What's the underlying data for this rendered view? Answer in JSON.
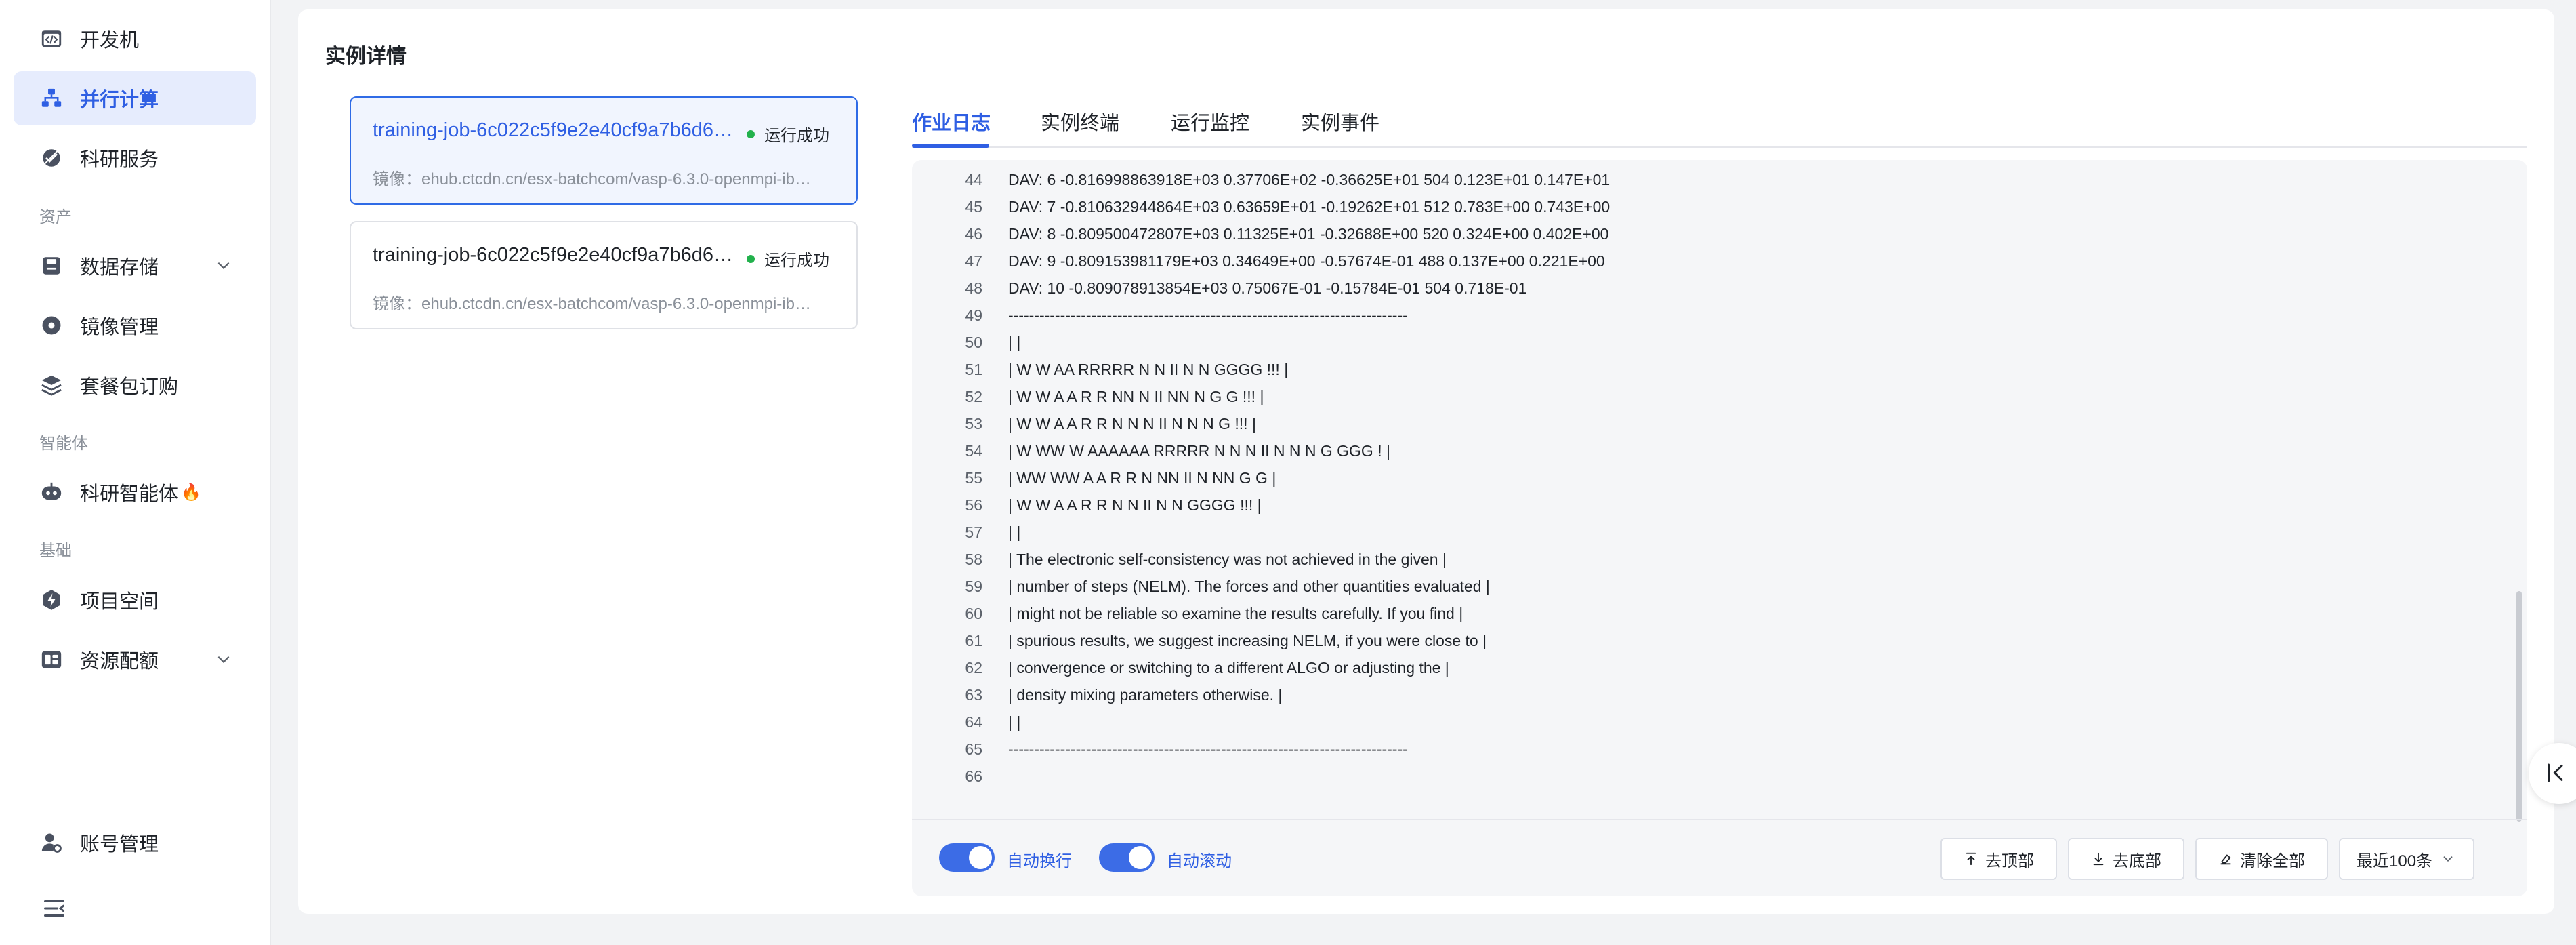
{
  "sidebar": {
    "items": [
      {
        "label": "开发机",
        "icon": "code-window-icon"
      },
      {
        "label": "并行计算",
        "icon": "cluster-icon",
        "active": true
      },
      {
        "label": "科研服务",
        "icon": "service-icon"
      },
      {
        "label": "数据存储",
        "icon": "storage-icon",
        "expandable": true
      },
      {
        "label": "镜像管理",
        "icon": "disc-icon"
      },
      {
        "label": "套餐包订购",
        "icon": "layers-icon"
      },
      {
        "label": "科研智能体",
        "icon": "robot-icon"
      },
      {
        "label": "项目空间",
        "icon": "bolt-icon"
      },
      {
        "label": "资源配额",
        "icon": "quota-icon",
        "expandable": true
      },
      {
        "label": "账号管理",
        "icon": "user-gear-icon"
      }
    ],
    "sections": [
      "资产",
      "智能体",
      "基础"
    ],
    "fire_badge": "🔥",
    "collapse_icon": "menu-collapse-icon"
  },
  "detail": {
    "title": "实例详情",
    "instances": [
      {
        "job_name": "training-job-6c022c5f9e2e40cf9a7b6d6…",
        "status": "运行成功",
        "image": "镜像：ehub.ctcdn.cn/esx-batchcom/vasp-6.3.0-openmpi-ib…",
        "selected": true
      },
      {
        "job_name": "training-job-6c022c5f9e2e40cf9a7b6d6…",
        "status": "运行成功",
        "image": "镜像：ehub.ctcdn.cn/esx-batchcom/vasp-6.3.0-openmpi-ib…",
        "selected": false
      }
    ],
    "status_color": "#22b14c"
  },
  "tabs": [
    "作业日志",
    "实例终端",
    "运行监控",
    "实例事件"
  ],
  "log": {
    "lines": [
      {
        "n": "44",
        "t": "DAV:   6    -0.816998863918E+03    0.37706E+02   -0.36625E+01   504   0.123E+01    0.147E+01"
      },
      {
        "n": "45",
        "t": "DAV:   7    -0.810632944864E+03    0.63659E+01   -0.19262E+01   512   0.783E+00    0.743E+00"
      },
      {
        "n": "46",
        "t": "DAV:   8    -0.809500472807E+03    0.11325E+01   -0.32688E+00   520   0.324E+00    0.402E+00"
      },
      {
        "n": "47",
        "t": "DAV:   9    -0.809153981179E+03    0.34649E+00   -0.57674E-01   488   0.137E+00    0.221E+00"
      },
      {
        "n": "48",
        "t": "DAV:  10    -0.809078913854E+03    0.75067E-01   -0.15784E-01   504   0.718E-01"
      },
      {
        "n": "49",
        "t": "-----------------------------------------------------------------------------"
      },
      {
        "n": "50",
        "t": "|                                                                             |"
      },
      {
        "n": "51",
        "t": "|     W    W    AA    RRRRR   N    N  II  N    N   GGGG   !!!                 |"
      },
      {
        "n": "52",
        "t": "|     W    W   A  A   R    R  NN   N  II  NN   N  G    G  !!!                 |"
      },
      {
        "n": "53",
        "t": "|     W    W  A    A  R    R  N N  N  II  N N  N  G       !!!                 |"
      },
      {
        "n": "54",
        "t": "|     W WW W  AAAAAA  RRRRR   N  N N  II  N  N N  G  GGG   !                  |"
      },
      {
        "n": "55",
        "t": "|     WW  WW  A    A  R   R   N   NN  II  N   NN  G    G                      |"
      },
      {
        "n": "56",
        "t": "|     W    W  A    A  R    R  N    N  II  N    N   GGGG   !!!                 |"
      },
      {
        "n": "57",
        "t": "|                                                                             |"
      },
      {
        "n": "58",
        "t": "|     The electronic self-consistency was not achieved in the given           |"
      },
      {
        "n": "59",
        "t": "|     number of steps (NELM). The forces and other quantities evaluated       |"
      },
      {
        "n": "60",
        "t": "|     might not be reliable so examine the results carefully. If you find     |"
      },
      {
        "n": "61",
        "t": "|     spurious results, we suggest increasing NELM, if you were close to      |"
      },
      {
        "n": "62",
        "t": "|     convergence or switching to a different ALGO or adjusting the           |"
      },
      {
        "n": "63",
        "t": "|     density mixing parameters otherwise.                                    |"
      },
      {
        "n": "64",
        "t": "|                                                                             |"
      },
      {
        "n": "65",
        "t": "-----------------------------------------------------------------------------"
      },
      {
        "n": "66",
        "t": ""
      }
    ],
    "auto_wrap_label": "自动换行",
    "auto_scroll_label": "自动滚动",
    "auto_wrap_on": true,
    "auto_scroll_on": true,
    "to_top_label": "去顶部",
    "to_bottom_label": "去底部",
    "clear_all_label": "清除全部",
    "range_select": "最近100条"
  },
  "colors": {
    "accent": "#2f5fe3",
    "active_bg": "#e6ecfd",
    "log_bg": "#f5f6f8"
  }
}
